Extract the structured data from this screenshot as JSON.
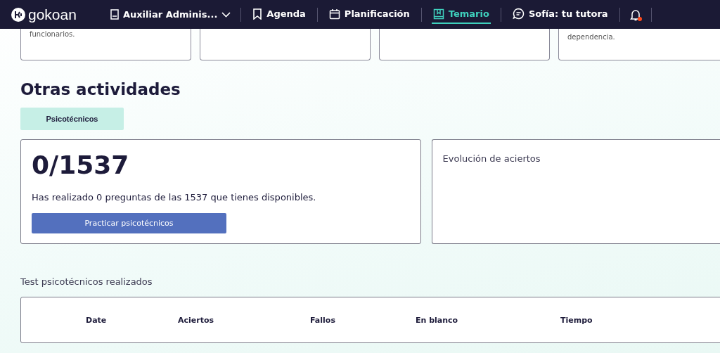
{
  "header": {
    "logo": "gokoan",
    "course": "Auxiliar Adminis...",
    "nav": [
      {
        "kind": "agenda",
        "label": "Agenda",
        "selected": false
      },
      {
        "kind": "calendar",
        "label": "Planificación",
        "selected": false
      },
      {
        "kind": "book",
        "label": "Temario",
        "selected": true
      },
      {
        "kind": "chat",
        "label": "Sofía: tu tutora",
        "selected": false
      }
    ],
    "notifications": {
      "unread": true
    }
  },
  "top_cards": [
    {
      "kind": "text",
      "text": "funcionarios."
    },
    {
      "kind": "blank"
    },
    {
      "kind": "blank"
    },
    {
      "kind": "text",
      "text": "dependencia."
    }
  ],
  "section_title": "Otras actividades",
  "tabs": [
    {
      "label": "Psicotécnicos",
      "selected": true
    }
  ],
  "progress_card": {
    "count": "0/1537",
    "description": "Has realizado 0 preguntas de las 1537 que tienes disponibles.",
    "button": "Practicar psicotécnicos"
  },
  "chart_card": {
    "title": "Evolución de aciertos"
  },
  "history": {
    "title": "Test psicotécnicos realizados",
    "columns": [
      "Date",
      "Aciertos",
      "Fallos",
      "En blanco",
      "Tiempo"
    ]
  }
}
